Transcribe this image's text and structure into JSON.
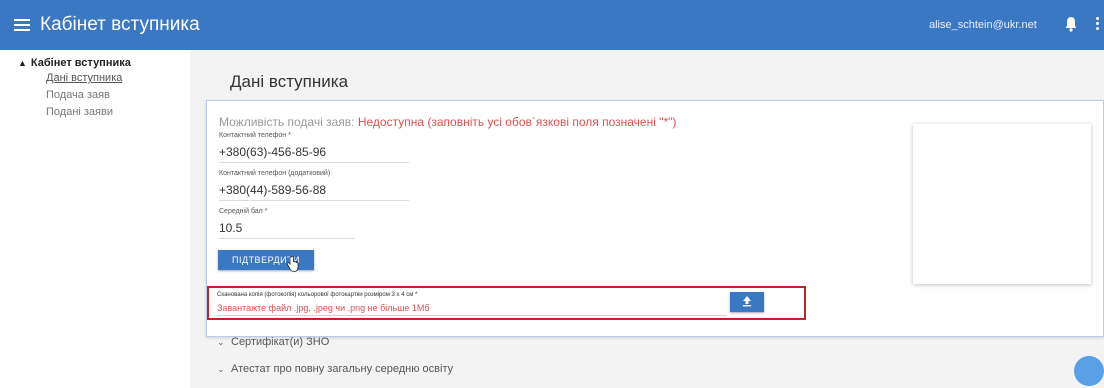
{
  "header": {
    "title": "Кабінет вступника",
    "user_email": "alise_schtein@ukr.net",
    "accent_color": "#3b78c4"
  },
  "sidebar": {
    "section_title": "Кабінет вступника",
    "items": [
      {
        "label": "Дані вступника",
        "active": true
      },
      {
        "label": "Подача заяв",
        "active": false
      },
      {
        "label": "Подані заяви",
        "active": false
      }
    ]
  },
  "main": {
    "page_title": "Дані вступника",
    "notice_prefix": "Можливість подачі заяв:",
    "notice_status": "Недоступна (заповніть усі обов`язкові поля позначені \"*\")",
    "fields": [
      {
        "label": "Контактний телефон *",
        "value": "+380(63)-456-85-96"
      },
      {
        "label": "Контактний телефон (додатковий)",
        "value": "+380(44)-589-56-88"
      },
      {
        "label": "Середній бал *",
        "value": "10.5"
      }
    ],
    "confirm_label": "ПІДТВЕРДИТИ",
    "upload": {
      "label": "Сканована копія (фотокопія) кольорової фотокартки розміром 3 х 4 см *",
      "hint": "Завантажте файл .jpg, .jpeg чи .png не більше 1Мб"
    },
    "sections": [
      {
        "label": "Сертифікат(и) ЗНО"
      },
      {
        "label": "Атестат про повну загальну середню освіту"
      }
    ]
  },
  "colors": {
    "error_red": "#d9534f",
    "highlight_border": "#c0232b"
  }
}
